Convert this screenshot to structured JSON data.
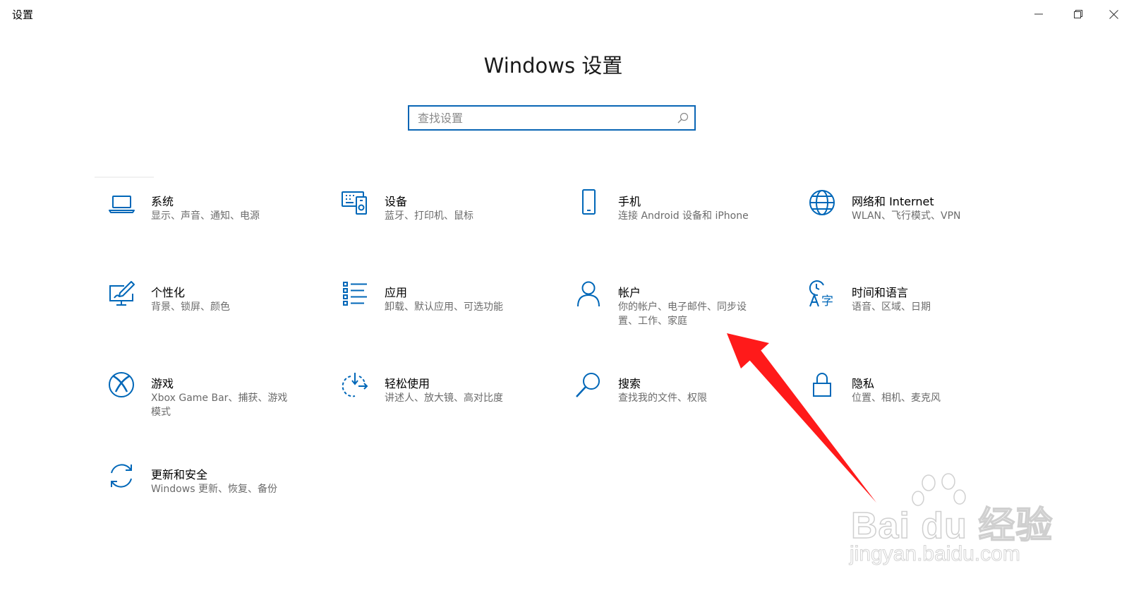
{
  "window": {
    "app_title": "设置",
    "controls": {
      "minimize": "minimize",
      "maximize": "restore",
      "close": "close"
    }
  },
  "header": {
    "title": "Windows 设置"
  },
  "search": {
    "placeholder": "查找设置",
    "value": ""
  },
  "accent_color": "#0067b8",
  "tiles": [
    {
      "title": "系统",
      "desc": "显示、声音、通知、电源",
      "icon": "laptop-icon"
    },
    {
      "title": "设备",
      "desc": "蓝牙、打印机、鼠标",
      "icon": "devices-icon"
    },
    {
      "title": "手机",
      "desc": "连接 Android 设备和 iPhone",
      "icon": "phone-icon"
    },
    {
      "title": "网络和 Internet",
      "desc": "WLAN、飞行模式、VPN",
      "icon": "globe-icon"
    },
    {
      "title": "个性化",
      "desc": "背景、锁屏、颜色",
      "icon": "personalization-icon"
    },
    {
      "title": "应用",
      "desc": "卸载、默认应用、可选功能",
      "icon": "apps-list-icon"
    },
    {
      "title": "帐户",
      "desc": "你的帐户、电子邮件、同步设置、工作、家庭",
      "icon": "person-icon"
    },
    {
      "title": "时间和语言",
      "desc": "语音、区域、日期",
      "icon": "time-language-icon"
    },
    {
      "title": "游戏",
      "desc": "Xbox Game Bar、捕获、游戏模式",
      "icon": "xbox-icon"
    },
    {
      "title": "轻松使用",
      "desc": "讲述人、放大镜、高对比度",
      "icon": "ease-of-access-icon"
    },
    {
      "title": "搜索",
      "desc": "查找我的文件、权限",
      "icon": "search-magnifier-icon"
    },
    {
      "title": "隐私",
      "desc": "位置、相机、麦克风",
      "icon": "lock-icon"
    },
    {
      "title": "更新和安全",
      "desc": "Windows 更新、恢复、备份",
      "icon": "sync-icon"
    }
  ],
  "annotation": {
    "color": "#ff1a1a"
  },
  "watermark": {
    "main": "Bai du 经验",
    "sub": "jingyan.baidu.com"
  }
}
